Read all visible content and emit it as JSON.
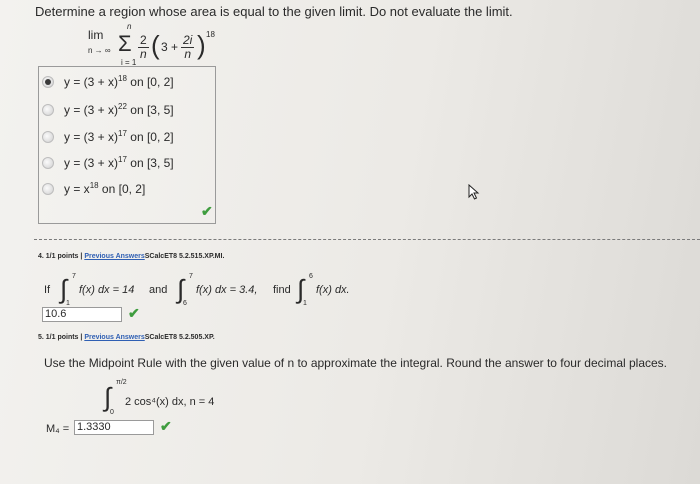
{
  "q3": {
    "prompt": "Determine a region whose area is equal to the given limit. Do not evaluate the limit.",
    "limit": {
      "lim": "lim",
      "lim_sub": "n → ∞",
      "sigma": "Σ",
      "sigma_top": "n",
      "sigma_bottom": "i = 1",
      "frac1_num": "2",
      "frac1_den": "n",
      "three": "3 +",
      "frac2_num": "2i",
      "frac2_den": "n",
      "exponent": "18"
    },
    "options": [
      {
        "base": "y = (3 + x)",
        "power": "18",
        "interval": " on [0, 2]",
        "selected": true
      },
      {
        "base": "y = (3 + x)",
        "power": "22",
        "interval": " on [3, 5]",
        "selected": false
      },
      {
        "base": "y = (3 + x)",
        "power": "17",
        "interval": " on [0, 2]",
        "selected": false
      },
      {
        "base": "y = (3 + x)",
        "power": "17",
        "interval": " on [3, 5]",
        "selected": false
      },
      {
        "base": "y = x",
        "power": "18",
        "interval": " on [0, 2]",
        "selected": false
      }
    ]
  },
  "q4": {
    "header": "4. 1/1 points |",
    "link": "Previous Answers",
    "code": "SCalcET8 5.2.515.XP.MI.",
    "if": "If",
    "int1": {
      "upper": "7",
      "lower": "1",
      "integrand": "f(x) dx = 14",
      "and": "and"
    },
    "int2": {
      "upper": "7",
      "lower": "6",
      "integrand": "f(x) dx = 3.4,",
      "find": "find"
    },
    "int3": {
      "upper": "6",
      "lower": "1",
      "integrand": "f(x) dx."
    },
    "answer": "10.6"
  },
  "q5": {
    "header": "5. 1/1 points |",
    "link": "Previous Answers",
    "code": "SCalcET8 5.2.505.XP.",
    "prompt": "Use the Midpoint Rule with the given value of n to approximate the integral. Round the answer to four decimal places.",
    "upper": "π/2",
    "lower": "0",
    "integrand": "2 cos⁴(x) dx, n = 4",
    "m_label": "M₄ =",
    "answer": "1.3330"
  },
  "icons": {
    "check_color": "#3f9d3f",
    "link_color": "#2f5fb3"
  }
}
